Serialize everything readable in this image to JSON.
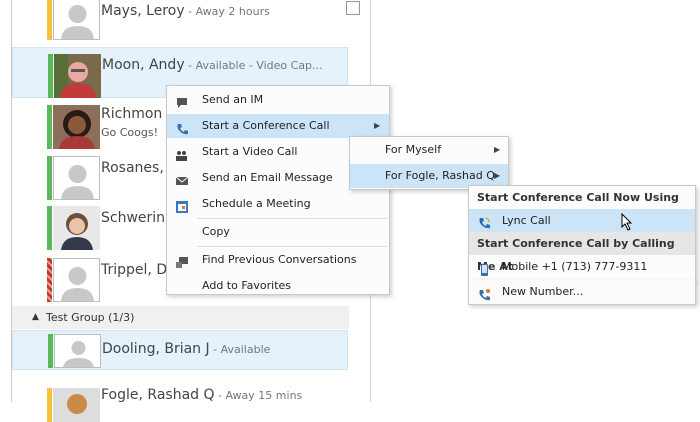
{
  "contacts": [
    {
      "name": "Mays, Leroy",
      "status": " - Away 2 hours",
      "presence": "#f7c23b"
    },
    {
      "name": "Moon, Andy",
      "status": " - Available - Video Cap...",
      "presence": "#5cb85c"
    },
    {
      "name": "Richmon",
      "note": "Go Coogs!",
      "presence": "#5cb85c"
    },
    {
      "name": "Rosanes,",
      "presence": "#5cb85c"
    },
    {
      "name": "Schwerin",
      "presence": "#5cb85c"
    },
    {
      "name": "Trippel, D",
      "presence": "#c0392b"
    },
    {
      "name": "Dooling, Brian J",
      "status": " - Available",
      "presence": "#5cb85c"
    },
    {
      "name": "Fogle, Rashad Q",
      "status": " - Away 15 mins",
      "presence": "#f7c23b"
    }
  ],
  "group": {
    "label": "Test Group (1/3)",
    "toggle_icon": "triangle-down-icon"
  },
  "context_menu": {
    "items": [
      {
        "label": "Send an IM",
        "icon": "im-icon"
      },
      {
        "label": "Start a Conference Call",
        "icon": "phone-icon"
      },
      {
        "label": "Start a Video Call",
        "icon": "video-people-icon"
      },
      {
        "label": "Send an Email Message",
        "icon": "envelope-icon"
      },
      {
        "label": "Schedule a Meeting",
        "icon": "calendar-icon"
      },
      {
        "label": "Copy",
        "icon": ""
      },
      {
        "label": "Find Previous Conversations",
        "icon": "history-icon"
      },
      {
        "label": "Add to Favorites",
        "icon": ""
      }
    ]
  },
  "submenu1": {
    "items": [
      {
        "label": "For Myself"
      },
      {
        "label": "For Fogle, Rashad Q"
      }
    ]
  },
  "submenu2": {
    "header1": "Start Conference Call Now Using",
    "lync_call": "Lync Call",
    "header2": "Start Conference Call by Calling Me At",
    "mobile": "Mobile +1 (713) 777-9311",
    "new_number": "New Number..."
  },
  "colors": {
    "selection": "#e5f1fb",
    "menu_highlight": "#cce4f7",
    "available": "#5cb85c",
    "away": "#f7c23b",
    "busy": "#c0392b"
  }
}
